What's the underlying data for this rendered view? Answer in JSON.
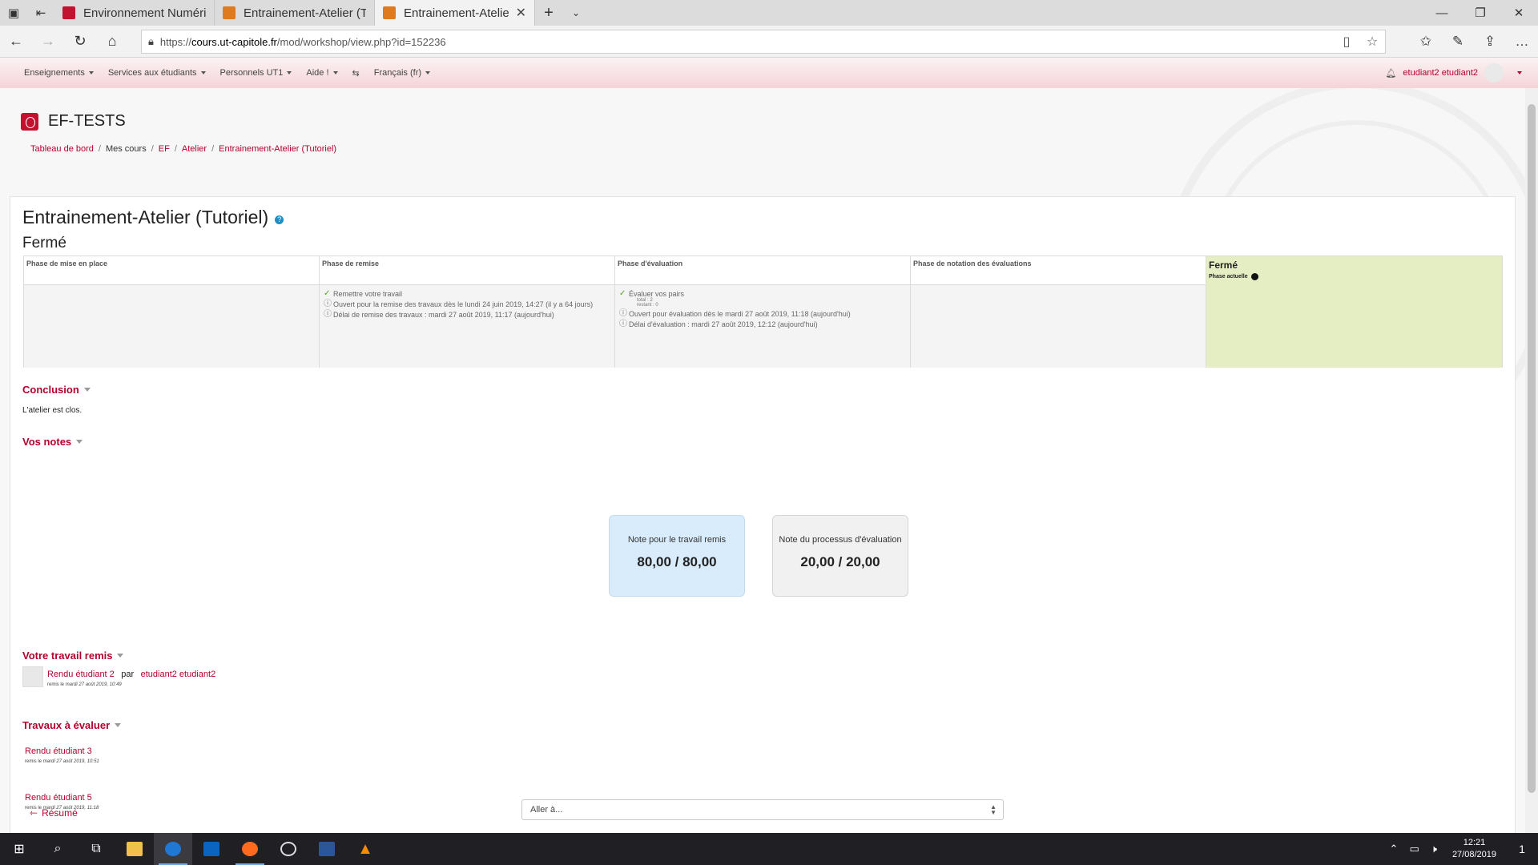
{
  "browser": {
    "tabs": [
      {
        "title": "Environnement Numérique",
        "favicon_color": "#c3122f"
      },
      {
        "title": "Entrainement-Atelier (Tutor",
        "favicon_color": "#e07a1f"
      },
      {
        "title": "Entrainement-Atelier (T(",
        "favicon_color": "#e07a1f",
        "active": true
      }
    ],
    "url_prefix": "https://",
    "url_host": "cours.ut-capitole.fr",
    "url_path": "/mod/workshop/view.php?id=152236"
  },
  "moodle_nav": {
    "items": [
      "Enseignements",
      "Services aux étudiants",
      "Personnels UT1",
      "Aide !",
      "Français (fr)"
    ],
    "user_name": "etudiant2 etudiant2"
  },
  "course": {
    "title": "EF-TESTS",
    "breadcrumb": [
      "Tableau de bord",
      "Mes cours",
      "EF",
      "Atelier",
      "Entrainement-Atelier (Tutoriel)"
    ]
  },
  "workshop": {
    "title": "Entrainement-Atelier (Tutoriel)",
    "help": "?",
    "current_phase": "Fermé",
    "phases": [
      {
        "title": "Phase de mise en place"
      },
      {
        "title": "Phase de remise",
        "task": "Remettre votre travail",
        "info1": "Ouvert pour la remise des travaux dès le lundi 24 juin 2019, 14:27 (il y a 64 jours)",
        "info2": "Délai de remise des travaux : mardi 27 août 2019, 11:17 (aujourd'hui)"
      },
      {
        "title": "Phase d'évaluation",
        "task": "Évaluer vos pairs",
        "total": "total : 2",
        "restant": "restant : 0",
        "info1": "Ouvert pour évaluation dès le mardi 27 août 2019, 11:18 (aujourd'hui)",
        "info2": "Délai d'évaluation : mardi 27 août 2019, 12:12 (aujourd'hui)"
      },
      {
        "title": "Phase de notation des évaluations"
      },
      {
        "title": "Fermé",
        "current_label": "Phase actuelle"
      }
    ]
  },
  "conclusion": {
    "title": "Conclusion",
    "text": "L'atelier est clos."
  },
  "grades": {
    "title": "Vos notes",
    "submission_label": "Note pour le travail remis",
    "submission_value": "80,00 / 80,00",
    "assessment_label": "Note du processus d'évaluation",
    "assessment_value": "20,00 / 20,00"
  },
  "submission": {
    "title": "Votre travail remis",
    "name": "Rendu étudiant 2",
    "by": "par",
    "author": "etudiant2 etudiant2",
    "meta_prefix": "remis le",
    "meta_date": "mardi 27 août 2019, 10:49"
  },
  "to_assess": {
    "title": "Travaux à évaluer",
    "items": [
      {
        "name": "Rendu étudiant 3",
        "meta_prefix": "remis le",
        "meta_date": "mardi 27 août 2019, 10:51"
      },
      {
        "name": "Rendu étudiant 5",
        "meta_prefix": "remis le",
        "meta_date": "mardi 27 août 2019, 11:18"
      }
    ]
  },
  "footer_nav": {
    "previous": "Résumé",
    "jump_placeholder": "Aller à..."
  },
  "taskbar": {
    "time": "12:21",
    "date": "27/08/2019",
    "notifications": "1"
  }
}
